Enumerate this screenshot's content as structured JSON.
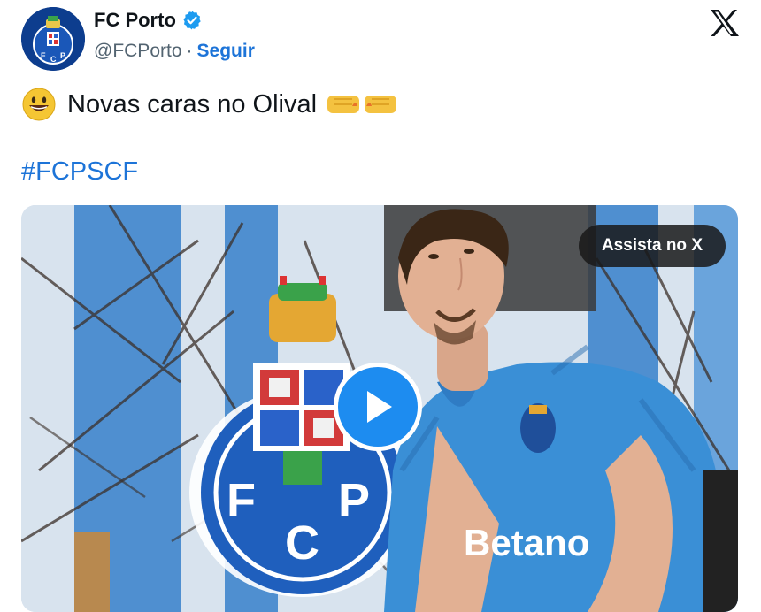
{
  "author": {
    "display_name": "FC Porto",
    "handle": "@FCPorto",
    "separator": "·",
    "follow_label": "Seguir",
    "verified": true,
    "avatar_icon": "fc-porto-crest-icon"
  },
  "platform": {
    "logo_icon": "x-logo-icon"
  },
  "tweet": {
    "text": "Novas caras no Olival",
    "leading_emoji": "grinning-face",
    "trailing_emoji": "fist-bump",
    "hashtag": "#FCPSCF"
  },
  "media": {
    "type": "video",
    "watch_label": "Assista no X",
    "play_icon": "play-icon",
    "sponsor_text": "Betano",
    "crest_letters": [
      "F",
      "C",
      "P"
    ]
  },
  "colors": {
    "link": "#1d74d8",
    "play": "#1d8cf0",
    "verified": "#1d9bf0",
    "shirt": "#3a8fd6"
  }
}
